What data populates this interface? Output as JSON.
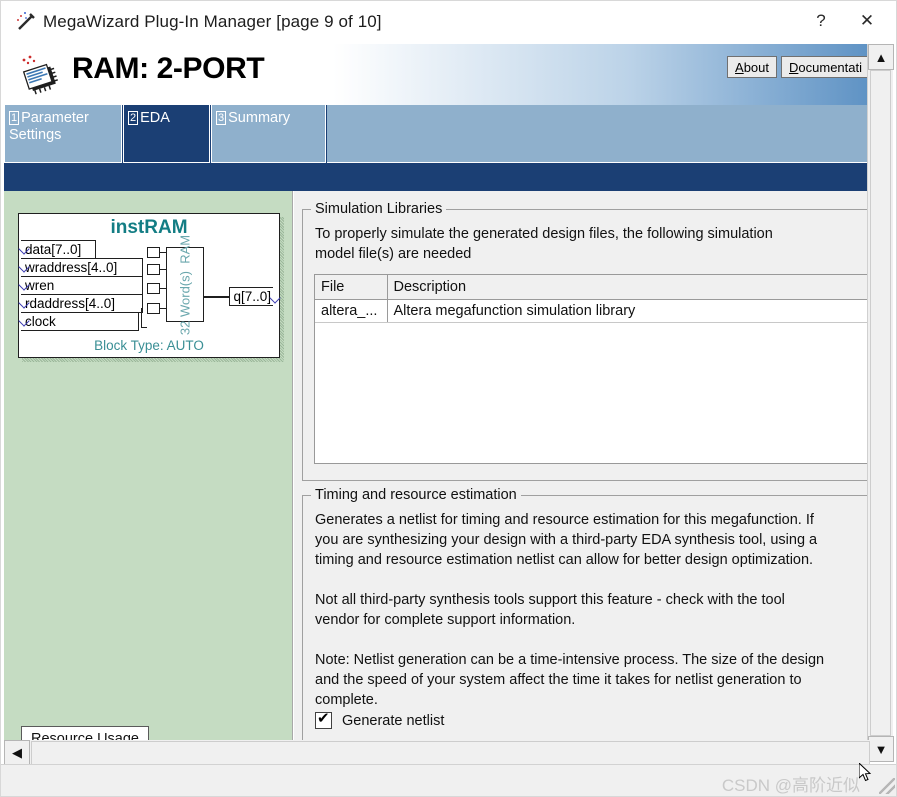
{
  "window": {
    "title": "MegaWizard Plug-In Manager [page 9 of 10]",
    "icon": "wand-icon",
    "help_label": "?",
    "close_label": "✕"
  },
  "header": {
    "title": "RAM: 2-PORT",
    "logo": "altera-chip-icon",
    "buttons": [
      {
        "name": "about",
        "label": "About",
        "mnemonic": "A"
      },
      {
        "name": "documentation",
        "label": "Documentati",
        "mnemonic": "D"
      }
    ]
  },
  "tabs": [
    {
      "num": "1",
      "label": "Parameter Settings",
      "active": false
    },
    {
      "num": "2",
      "label": "EDA",
      "active": true
    },
    {
      "num": "3",
      "label": "Summary",
      "active": false
    }
  ],
  "diagram": {
    "title": "instRAM",
    "inputs": [
      {
        "label": "data[7..0]"
      },
      {
        "label": "wraddress[4..0]"
      },
      {
        "label": "wren"
      },
      {
        "label": "rdaddress[4..0]"
      },
      {
        "label": "clock"
      }
    ],
    "output": "q[7..0]",
    "core_label": "32 Word(s)\nRAM",
    "block_type": "Block Type: AUTO",
    "resource_usage_button": "Resource Usage",
    "colors": {
      "accent": "#137d84",
      "panel": "#c5dcc2"
    }
  },
  "simulation_libraries": {
    "legend": "Simulation Libraries",
    "description_line1": "To properly simulate the generated design files, the following simulation",
    "description_line2": "model file(s) are needed",
    "table": {
      "columns": [
        "File",
        "Description"
      ],
      "rows": [
        [
          "altera_...",
          "Altera megafunction simulation library"
        ]
      ]
    }
  },
  "timing_estimation": {
    "legend": "Timing and resource estimation",
    "paragraphs": [
      "Generates a netlist for timing and resource estimation for this megafunction. If\nyou are synthesizing your design with a third-party EDA synthesis tool, using a\ntiming and resource estimation netlist can allow for better design optimization.",
      "Not all third-party synthesis tools support this feature - check with the tool\nvendor for complete support information.",
      "Note: Netlist generation can be a time-intensive process. The size of the design\nand the speed of your system affect the time it takes for netlist generation to\ncomplete."
    ],
    "checkbox": {
      "label": "Generate netlist",
      "checked": true
    }
  },
  "scrollbars": {
    "vertical_up": "▲",
    "vertical_down": "▼",
    "horizontal_left": "◀"
  },
  "status": {
    "watermark": "CSDN @高阶近似"
  }
}
